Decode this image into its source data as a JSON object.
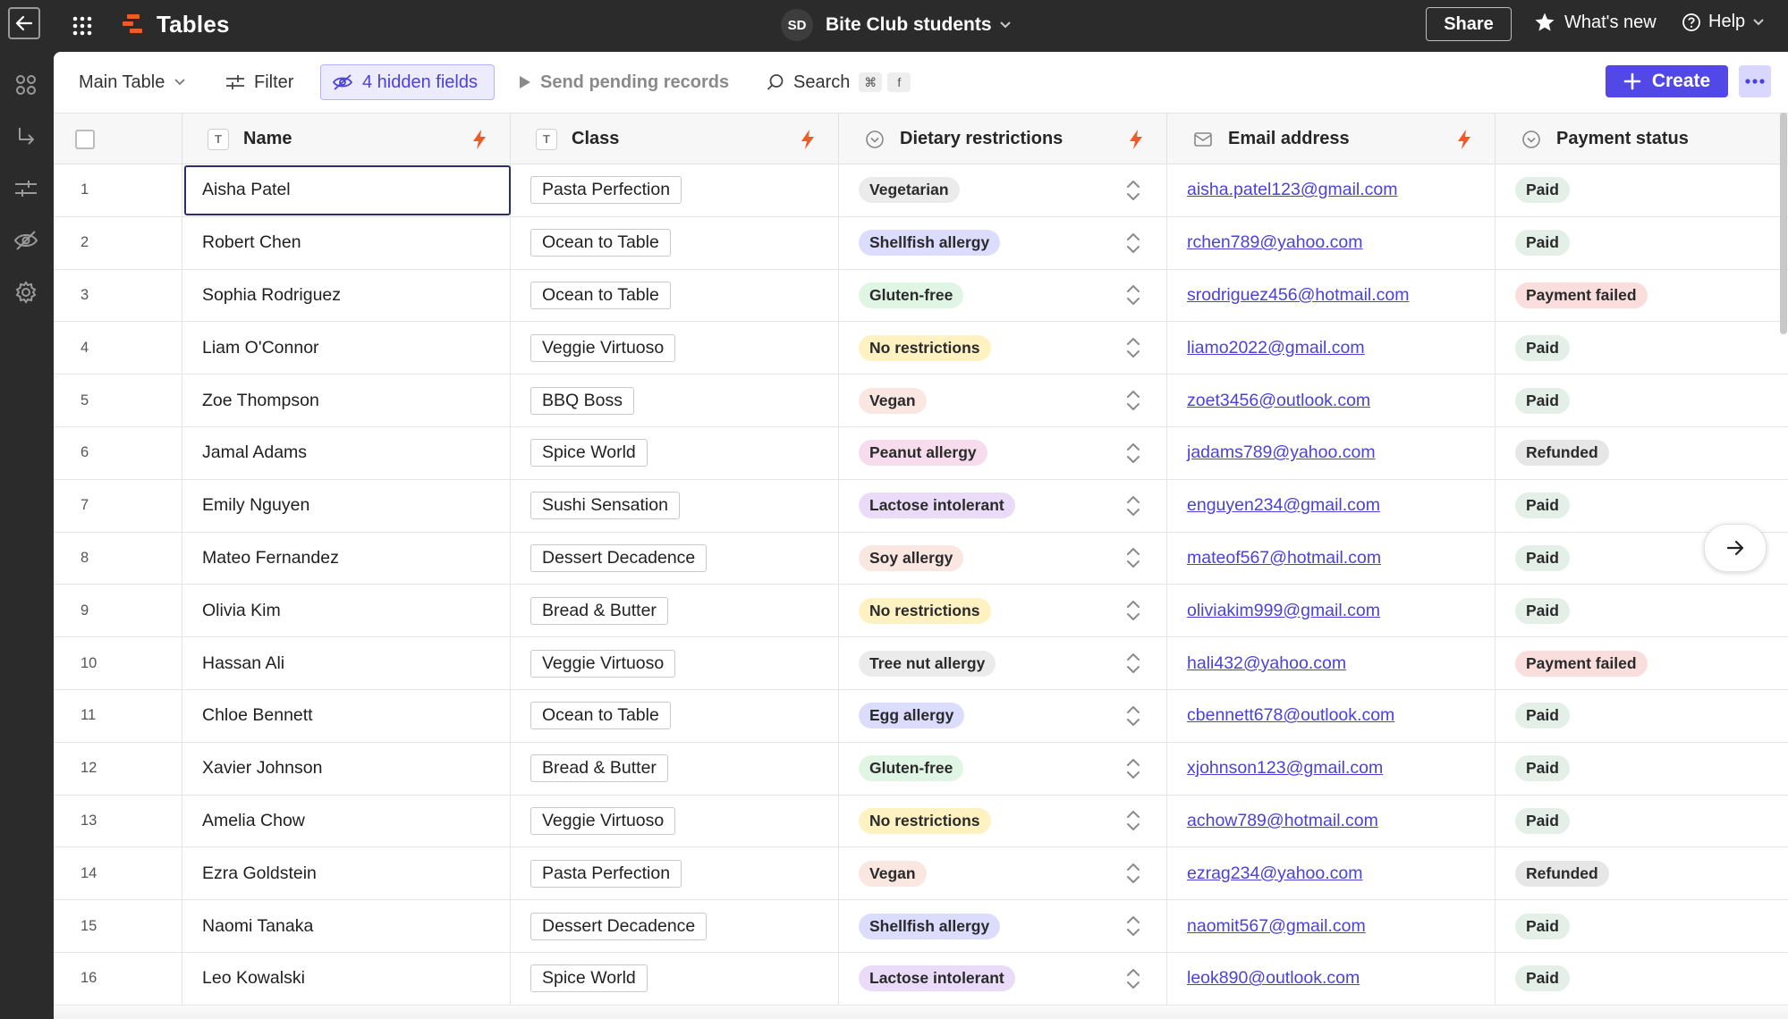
{
  "app": {
    "title": "Tables",
    "base_initials": "SD",
    "base_name": "Bite Club students",
    "share_label": "Share",
    "whats_new_label": "What's new",
    "help_label": "Help"
  },
  "toolbar": {
    "view_label": "Main Table",
    "filter_label": "Filter",
    "hidden_fields_label": "4 hidden fields",
    "send_pending_label": "Send pending records",
    "search_label": "Search",
    "search_kbd_cmd": "⌘",
    "search_kbd_key": "f",
    "create_label": "Create"
  },
  "columns": {
    "name": "Name",
    "class": "Class",
    "dietary": "Dietary restrictions",
    "email": "Email address",
    "payment": "Payment status"
  },
  "colors": {
    "accent": "#5248e8",
    "bolt": "#f05a28",
    "pill_grey": "#ebebeb",
    "pill_purple": "#dcdcff",
    "pill_green": "#e1f5e5",
    "pill_yellow": "#fff2c2",
    "pill_orange": "#fbe7e2",
    "pill_pink": "#f6dcec",
    "pill_lavender": "#eadcf8",
    "pay_paid": "#e3efe7",
    "pay_failed": "#fadede",
    "pay_refunded": "#e6e6e6"
  },
  "rows": [
    {
      "num": "1",
      "name": "Aisha Patel",
      "class": "Pasta Perfection",
      "diet": "Vegetarian",
      "diet_color": "pill_grey",
      "email": "aisha.patel123@gmail.com",
      "payment": "Paid",
      "pay_color": "pay_paid"
    },
    {
      "num": "2",
      "name": "Robert Chen",
      "class": "Ocean to Table",
      "diet": "Shellfish allergy",
      "diet_color": "pill_purple",
      "email": "rchen789@yahoo.com",
      "payment": "Paid",
      "pay_color": "pay_paid"
    },
    {
      "num": "3",
      "name": "Sophia Rodriguez",
      "class": "Ocean to Table",
      "diet": "Gluten-free",
      "diet_color": "pill_green",
      "email": "srodriguez456@hotmail.com",
      "payment": "Payment failed",
      "pay_color": "pay_failed"
    },
    {
      "num": "4",
      "name": "Liam O'Connor",
      "class": "Veggie Virtuoso",
      "diet": "No restrictions",
      "diet_color": "pill_yellow",
      "email": "liamo2022@gmail.com",
      "payment": "Paid",
      "pay_color": "pay_paid"
    },
    {
      "num": "5",
      "name": "Zoe Thompson",
      "class": "BBQ Boss",
      "diet": "Vegan",
      "diet_color": "pill_orange",
      "email": "zoet3456@outlook.com",
      "payment": "Paid",
      "pay_color": "pay_paid"
    },
    {
      "num": "6",
      "name": "Jamal Adams",
      "class": "Spice World",
      "diet": "Peanut allergy",
      "diet_color": "pill_pink",
      "email": "jadams789@yahoo.com",
      "payment": "Refunded",
      "pay_color": "pay_refunded"
    },
    {
      "num": "7",
      "name": "Emily Nguyen",
      "class": "Sushi Sensation",
      "diet": "Lactose intolerant",
      "diet_color": "pill_lavender",
      "email": "enguyen234@gmail.com",
      "payment": "Paid",
      "pay_color": "pay_paid"
    },
    {
      "num": "8",
      "name": "Mateo Fernandez",
      "class": "Dessert Decadence",
      "diet": "Soy allergy",
      "diet_color": "pill_orange",
      "email": "mateof567@hotmail.com",
      "payment": "Paid",
      "pay_color": "pay_paid"
    },
    {
      "num": "9",
      "name": "Olivia Kim",
      "class": "Bread & Butter",
      "diet": "No restrictions",
      "diet_color": "pill_yellow",
      "email": "oliviakim999@gmail.com",
      "payment": "Paid",
      "pay_color": "pay_paid"
    },
    {
      "num": "10",
      "name": "Hassan Ali",
      "class": "Veggie Virtuoso",
      "diet": "Tree nut allergy",
      "diet_color": "pill_grey",
      "email": "hali432@yahoo.com",
      "payment": "Payment failed",
      "pay_color": "pay_failed"
    },
    {
      "num": "11",
      "name": "Chloe Bennett",
      "class": "Ocean to Table",
      "diet": "Egg allergy",
      "diet_color": "pill_purple",
      "email": "cbennett678@outlook.com",
      "payment": "Paid",
      "pay_color": "pay_paid"
    },
    {
      "num": "12",
      "name": "Xavier Johnson",
      "class": "Bread & Butter",
      "diet": "Gluten-free",
      "diet_color": "pill_green",
      "email": "xjohnson123@gmail.com",
      "payment": "Paid",
      "pay_color": "pay_paid"
    },
    {
      "num": "13",
      "name": "Amelia Chow",
      "class": "Veggie Virtuoso",
      "diet": "No restrictions",
      "diet_color": "pill_yellow",
      "email": "achow789@hotmail.com",
      "payment": "Paid",
      "pay_color": "pay_paid"
    },
    {
      "num": "14",
      "name": "Ezra Goldstein",
      "class": "Pasta Perfection",
      "diet": "Vegan",
      "diet_color": "pill_orange",
      "email": "ezrag234@yahoo.com",
      "payment": "Refunded",
      "pay_color": "pay_refunded"
    },
    {
      "num": "15",
      "name": "Naomi Tanaka",
      "class": "Dessert Decadence",
      "diet": "Shellfish allergy",
      "diet_color": "pill_purple",
      "email": "naomit567@gmail.com",
      "payment": "Paid",
      "pay_color": "pay_paid"
    },
    {
      "num": "16",
      "name": "Leo Kowalski",
      "class": "Spice World",
      "diet": "Lactose intolerant",
      "diet_color": "pill_lavender",
      "email": "leok890@outlook.com",
      "payment": "Paid",
      "pay_color": "pay_paid"
    }
  ]
}
